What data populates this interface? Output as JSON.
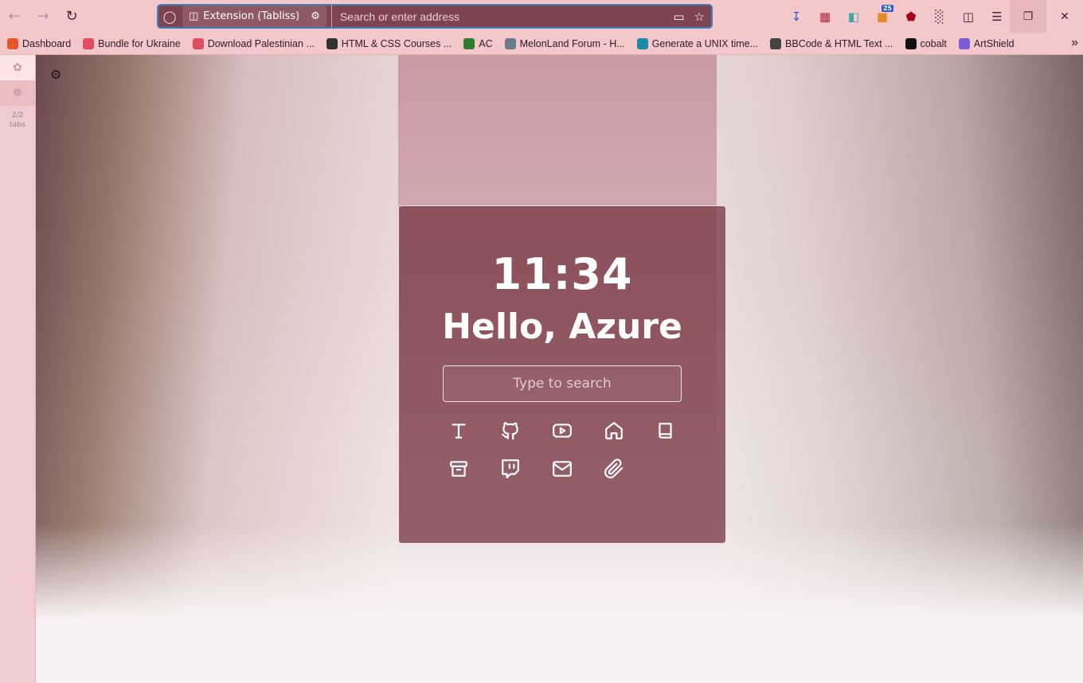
{
  "toolbar": {
    "icons": [
      "back-icon",
      "forward-icon",
      "reload-icon"
    ],
    "extension_label": "Extension (Tabliss)",
    "url_placeholder": "Search or enter address",
    "right_icons": [
      "download-icon",
      "library-icon",
      "reader-icon",
      "extension-badge-icon",
      "ublock-icon",
      "bin-icon",
      "extensions-icon",
      "menu-icon"
    ],
    "badge_count": "25"
  },
  "bookmarks": [
    {
      "label": "Dashboard",
      "color": "#e5572a"
    },
    {
      "label": "Bundle for Ukraine",
      "color": "#e04f5f"
    },
    {
      "label": "Download Palestinian ...",
      "color": "#e04f5f"
    },
    {
      "label": "HTML & CSS Courses ...",
      "color": "#333333"
    },
    {
      "label": "AC",
      "color": "#2e7d32"
    },
    {
      "label": "MelonLand Forum - H...",
      "color": "#6a7b8c"
    },
    {
      "label": "Generate a UNIX time...",
      "color": "#1c8aa5"
    },
    {
      "label": "BBCode & HTML Text ...",
      "color": "#444444"
    },
    {
      "label": "cobalt",
      "color": "#111111"
    },
    {
      "label": "ArtShield",
      "color": "#7a5cd6"
    }
  ],
  "sidebar": {
    "tab_count": "2/2",
    "tab_label": "tabs"
  },
  "dashboard": {
    "time": "11:34",
    "greeting": "Hello, Azure",
    "search_placeholder": "Type to search",
    "links": [
      "text-icon",
      "github-icon",
      "youtube-icon",
      "home-icon",
      "book-icon",
      "archive-icon",
      "twitch-icon",
      "mail-icon",
      "paperclip-icon"
    ]
  },
  "colors": {
    "accent": "#3e7fbd",
    "panel": "#7a3a44",
    "chrome": "#f4c8ca"
  }
}
